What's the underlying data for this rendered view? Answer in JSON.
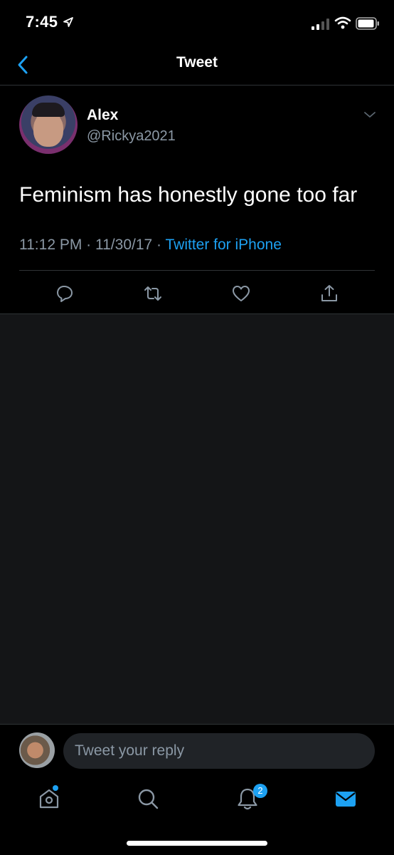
{
  "status_bar": {
    "time": "7:45"
  },
  "header": {
    "title": "Tweet"
  },
  "tweet": {
    "author_name": "Alex",
    "author_handle": "@Rickya2021",
    "text": "Feminism has honestly gone too far",
    "time": "11:12 PM",
    "date": "11/30/17",
    "source": "Twitter for iPhone"
  },
  "reply": {
    "placeholder": "Tweet your reply"
  },
  "tab_bar": {
    "notifications_badge": "2"
  },
  "colors": {
    "accent": "#1da1f2",
    "background": "#000000",
    "empty_area": "#141517",
    "secondary_text": "#8b98a5",
    "divider": "#2f3336"
  },
  "icons": [
    "location-arrow-icon",
    "signal-icon",
    "wifi-icon",
    "battery-icon",
    "back-chevron-icon",
    "chevron-down-icon",
    "reply-icon",
    "retweet-icon",
    "like-icon",
    "share-icon",
    "home-icon",
    "search-icon",
    "notifications-icon",
    "messages-icon"
  ]
}
